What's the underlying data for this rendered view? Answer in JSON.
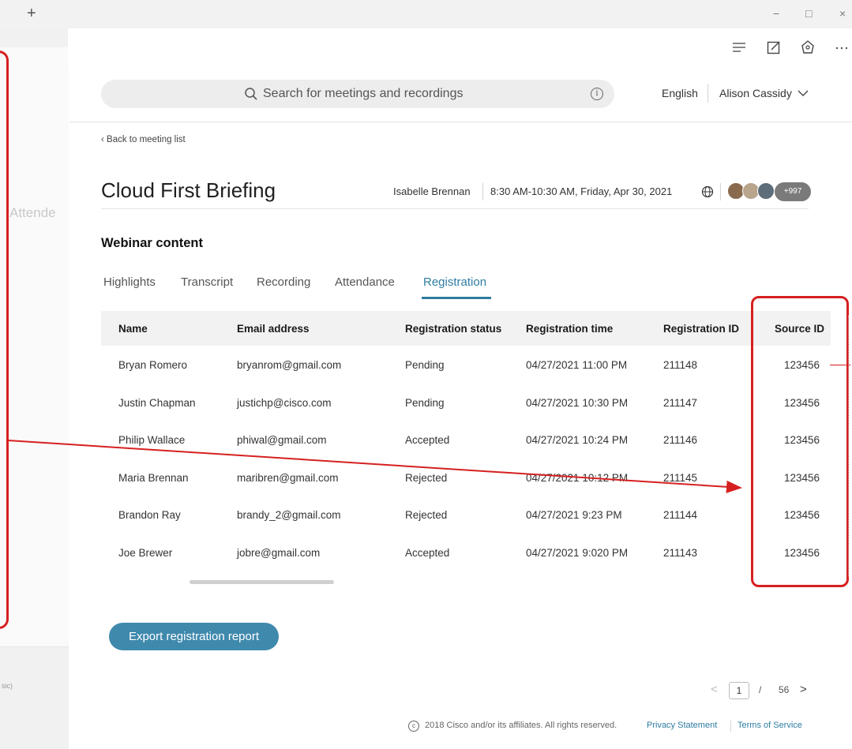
{
  "window": {
    "new_tab": "+",
    "minimize": "−",
    "maximize": "□",
    "close": "×"
  },
  "toolbar_icons": [
    "menu-lines-icon",
    "edit-icon",
    "feedback-icon",
    "more-icon"
  ],
  "left_panel": {
    "peek_text": "Attende",
    "tiny_text": "sic)"
  },
  "header": {
    "search_placeholder": "Search for meetings and recordings",
    "language": "English",
    "user_name": "Alison Cassidy"
  },
  "meeting": {
    "back_link": "Back to meeting list",
    "title": "Cloud First Briefing",
    "host": "Isabelle Brennan",
    "time": "8:30 AM-10:30 AM, Friday, Apr 30, 2021",
    "extra_participants": "+997",
    "avatar_colors": [
      "#8a6a4f",
      "#b9a48c",
      "#5d6e7a"
    ]
  },
  "content": {
    "section_title": "Webinar content",
    "tabs": [
      "Highlights",
      "Transcript",
      "Recording",
      "Attendance",
      "Registration"
    ],
    "active_tab": "Registration"
  },
  "table": {
    "columns": [
      "Name",
      "Email address",
      "Registration status",
      "Registration time",
      "Registration ID",
      "Source ID"
    ],
    "rows": [
      [
        "Bryan Romero",
        "bryanrom@gmail.com",
        "Pending",
        "04/27/2021 11:00 PM",
        "211148",
        "123456"
      ],
      [
        "Justin Chapman",
        "justichp@cisco.com",
        "Pending",
        "04/27/2021 10:30 PM",
        "211147",
        "123456"
      ],
      [
        "Philip Wallace",
        "phiwal@gmail.com",
        "Accepted",
        "04/27/2021 10:24 PM",
        "211146",
        "123456"
      ],
      [
        "Maria Brennan",
        "maribren@gmail.com",
        "Rejected",
        "04/27/2021 10:12 PM",
        "211145",
        "123456"
      ],
      [
        "Brandon Ray",
        "brandy_2@gmail.com",
        "Rejected",
        "04/27/2021 9:23 PM",
        "211144",
        "123456"
      ],
      [
        "Joe Brewer",
        "jobre@gmail.com",
        "Accepted",
        "04/27/2021 9:020 PM",
        "211143",
        "123456"
      ]
    ]
  },
  "export_button": "Export registration report",
  "pagination": {
    "prev": "<",
    "current": "1",
    "separator": "/",
    "total": "56",
    "next": ">"
  },
  "footer": {
    "copyright_symbol": "c",
    "copyright": "2018 Cisco and/or its affiliates. All rights reserved.",
    "privacy": "Privacy Statement",
    "terms": "Terms of Service"
  },
  "colors": {
    "accent": "#2f7ca1",
    "button": "#3f89ad",
    "annotation": "#d62020"
  }
}
